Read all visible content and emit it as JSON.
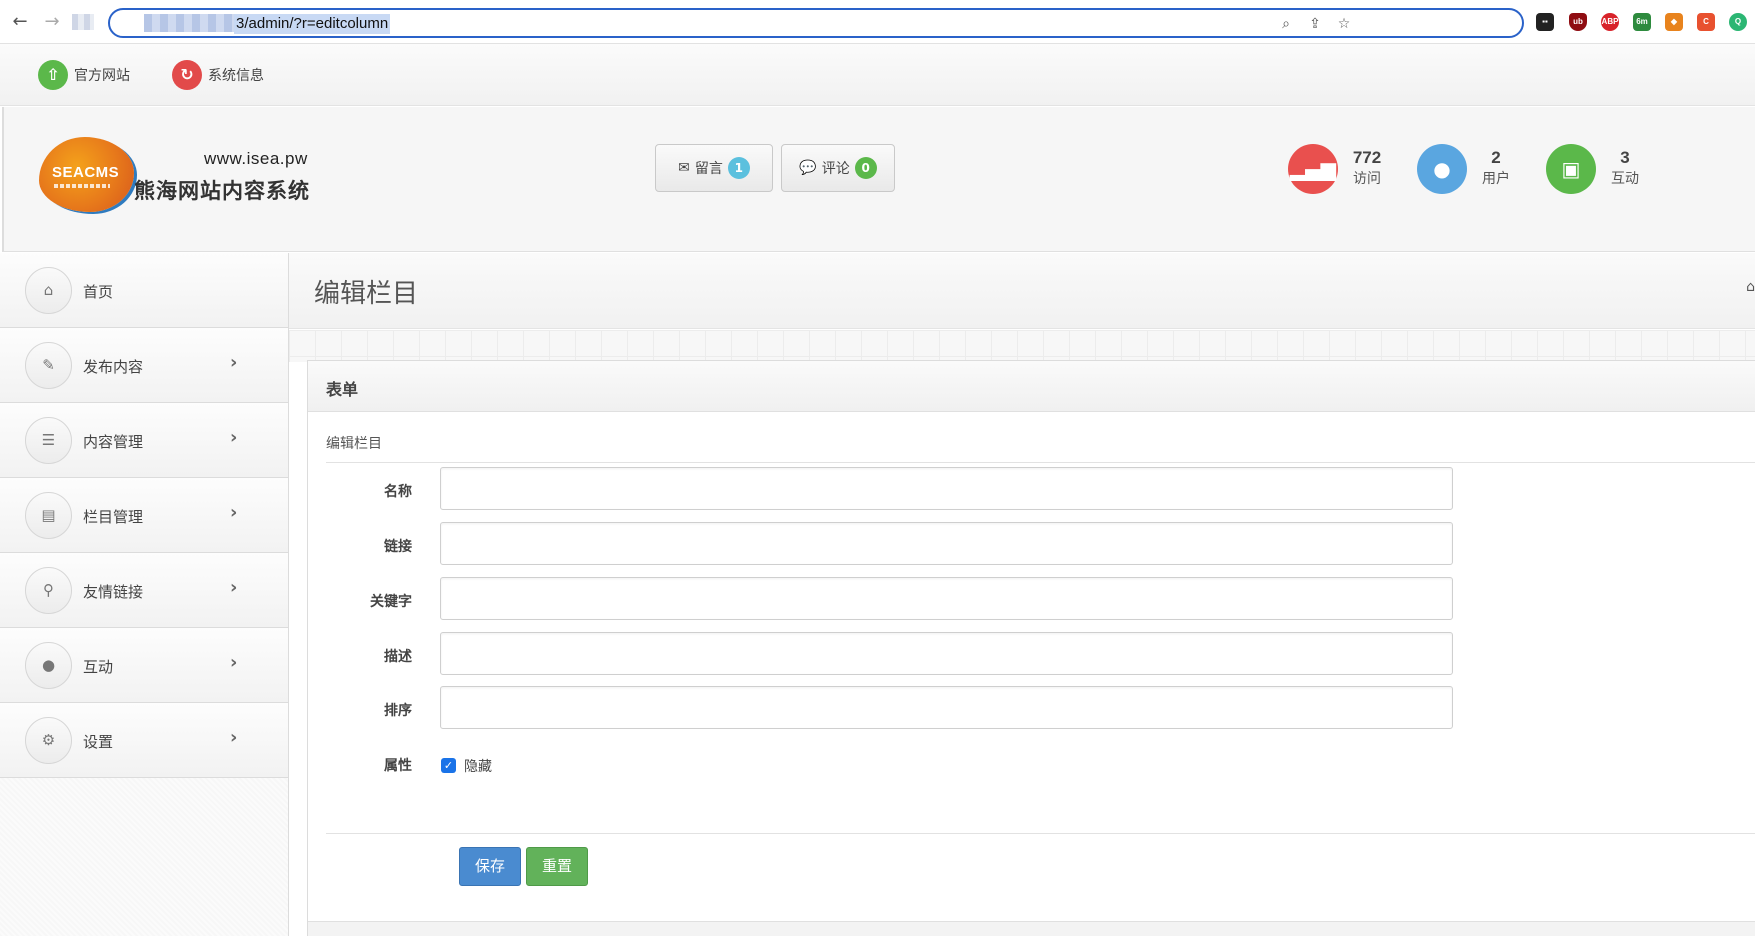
{
  "browser": {
    "url": "3/admin/?r=editcolumn",
    "back_icon": "arrow-left-icon",
    "forward_icon": "arrow-right-icon"
  },
  "util_bar": {
    "official_site": "官方网站",
    "system_info": "系统信息"
  },
  "header": {
    "logo_text": "SEACMS",
    "domain": "www.isea.pw",
    "site_name": "熊海网站内容系统",
    "messages": {
      "label": "留言",
      "count": "1"
    },
    "comments": {
      "label": "评论",
      "count": "0"
    },
    "stats": [
      {
        "value": "772",
        "label": "访问",
        "icon": "signal-icon",
        "color": "#e9504e"
      },
      {
        "value": "2",
        "label": "用户",
        "icon": "user-icon",
        "color": "#5aa6e0"
      },
      {
        "value": "3",
        "label": "互动",
        "icon": "money-icon",
        "color": "#5bb84a"
      }
    ]
  },
  "sidebar": {
    "items": [
      {
        "label": "首页",
        "icon": "home-icon"
      },
      {
        "label": "发布内容",
        "icon": "pencil-icon"
      },
      {
        "label": "内容管理",
        "icon": "list-icon"
      },
      {
        "label": "栏目管理",
        "icon": "column-icon"
      },
      {
        "label": "友情链接",
        "icon": "wand-icon"
      },
      {
        "label": "互动",
        "icon": "comments-icon"
      },
      {
        "label": "设置",
        "icon": "gears-icon"
      }
    ]
  },
  "main": {
    "page_title": "编辑栏目",
    "panel_title": "表单",
    "legend": "编辑栏目",
    "fields": [
      {
        "label": "名称",
        "value": ""
      },
      {
        "label": "链接",
        "value": ""
      },
      {
        "label": "关键字",
        "value": ""
      },
      {
        "label": "描述",
        "value": ""
      },
      {
        "label": "排序",
        "value": ""
      }
    ],
    "attribute_label": "属性",
    "hidden_checkbox": {
      "label": "隐藏",
      "checked": true
    },
    "save_label": "保存",
    "reset_label": "重置"
  }
}
